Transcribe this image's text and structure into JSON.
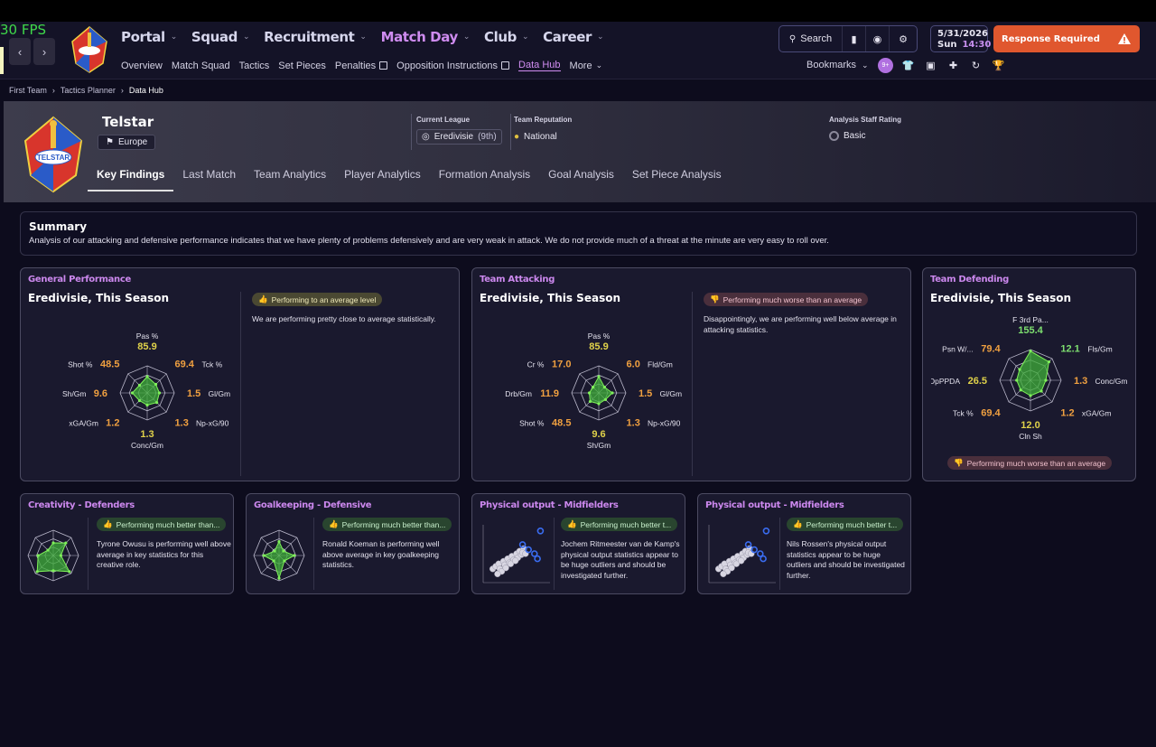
{
  "fps": "30 FPS",
  "nav": {
    "main": [
      {
        "label": "Portal",
        "active": false
      },
      {
        "label": "Squad",
        "active": false
      },
      {
        "label": "Recruitment",
        "active": false
      },
      {
        "label": "Match Day",
        "active": true
      },
      {
        "label": "Club",
        "active": false
      },
      {
        "label": "Career",
        "active": false
      }
    ],
    "sub": [
      {
        "label": "Overview",
        "active": false,
        "external": false
      },
      {
        "label": "Match Squad",
        "active": false,
        "external": false
      },
      {
        "label": "Tactics",
        "active": false,
        "external": false
      },
      {
        "label": "Set Pieces",
        "active": false,
        "external": false
      },
      {
        "label": "Penalties",
        "active": false,
        "external": true
      },
      {
        "label": "Opposition Instructions",
        "active": false,
        "external": true
      },
      {
        "label": "Data Hub",
        "active": true,
        "external": false
      },
      {
        "label": "More",
        "active": false,
        "external": false
      }
    ]
  },
  "toolbar": {
    "search_label": "Search",
    "date": "5/31/2026",
    "day": "Sun",
    "time": "14:30",
    "alert_label": "Response Required",
    "bookmarks_label": "Bookmarks",
    "chat_badge": "9+"
  },
  "breadcrumb": [
    "First Team",
    "Tactics Planner",
    "Data Hub"
  ],
  "team": {
    "name": "Telstar",
    "region": "Europe",
    "crest_text": "TELSTAR",
    "league_label": "Current League",
    "league_value": "Eredivisie",
    "league_position": "(9th)",
    "reputation_label": "Team Reputation",
    "reputation_value": "National",
    "staff_label": "Analysis Staff Rating",
    "staff_value": "Basic"
  },
  "tabs": [
    "Key Findings",
    "Last Match",
    "Team Analytics",
    "Player Analytics",
    "Formation Analysis",
    "Goal Analysis",
    "Set Piece Analysis"
  ],
  "summary": {
    "title": "Summary",
    "text": "Analysis of our attacking and defensive performance indicates that we have plenty of problems defensively and are very weak in attack. We do not provide much of a threat at the minute are very easy to roll over."
  },
  "cards": {
    "general": {
      "title": "General Performance",
      "subtitle": "Eredivisie, This Season",
      "badge": "Performing to an average level",
      "text": "We are performing pretty close to average statistically."
    },
    "attacking": {
      "title": "Team Attacking",
      "subtitle": "Eredivisie, This Season",
      "badge": "Performing much worse than an average",
      "text": "Disappointingly, we are performing well below average in attacking statistics."
    },
    "defending": {
      "title": "Team Defending",
      "subtitle": "Eredivisie, This Season",
      "badge": "Performing much worse than an average"
    },
    "creativity": {
      "title": "Creativity - Defenders",
      "badge": "Performing much better than...",
      "text": "Tyrone Owusu is performing well above average in key statistics for this creative role."
    },
    "goalkeeping": {
      "title": "Goalkeeping - Defensive",
      "badge": "Performing much better than...",
      "text": "Ronald Koeman is performing well above average in key goalkeeping statistics."
    },
    "physical1": {
      "title": "Physical output - Midfielders",
      "badge": "Performing much better t...",
      "text": "Jochem Ritmeester van de Kamp's physical output statistics appear to be huge outliers and should be investigated further."
    },
    "physical2": {
      "title": "Physical output - Midfielders",
      "badge": "Performing much better t...",
      "text": "Nils Rossen's physical output statistics appear to be huge outliers and should be investigated further."
    }
  },
  "colors": {
    "accent": "#cf8cf0",
    "alert": "#e0572e",
    "radar_fill": "#3fae3a",
    "radar_line": "#7ff05a",
    "value_orange": "#f0a040",
    "value_green": "#7ee070",
    "value_yellow": "#e0d24a"
  },
  "chart_data": [
    {
      "type": "radar",
      "name": "general",
      "axes": [
        "Pas %",
        "Tck %",
        "Gl/Gm",
        "Np-xG/90",
        "Conc/Gm",
        "xGA/Gm",
        "Sh/Gm",
        "Shot %"
      ],
      "values": [
        "85.9",
        "69.4",
        "1.5",
        "1.3",
        "1.3",
        "1.2",
        "9.6",
        "48.5"
      ],
      "levels": [
        0.6,
        0.45,
        0.45,
        0.5,
        0.45,
        0.4,
        0.55,
        0.4
      ]
    },
    {
      "type": "radar",
      "name": "attacking",
      "axes": [
        "Pas %",
        "Fld/Gm",
        "Gl/Gm",
        "Np-xG/90",
        "Sh/Gm",
        "Shot %",
        "Drb/Gm",
        "Cr %"
      ],
      "values": [
        "85.9",
        "6.0",
        "1.5",
        "1.3",
        "9.6",
        "48.5",
        "11.9",
        "17.0"
      ],
      "levels": [
        0.6,
        0.3,
        0.5,
        0.35,
        0.4,
        0.45,
        0.35,
        0.3
      ]
    },
    {
      "type": "radar",
      "name": "defending",
      "axes": [
        "F 3rd Pa...",
        "Fls/Gm",
        "Conc/Gm",
        "xGA/Gm",
        "Cln Sh",
        "Tck %",
        "OpPPDA",
        "Psn W/..."
      ],
      "values": [
        "155.4",
        "12.1",
        "1.3",
        "1.2",
        "12.0",
        "69.4",
        "26.5",
        "79.4"
      ],
      "levels": [
        0.95,
        0.85,
        0.5,
        0.5,
        0.5,
        0.45,
        0.45,
        0.5
      ]
    },
    {
      "type": "radar",
      "name": "creativity",
      "levels": [
        0.5,
        0.7,
        0.3,
        0.9,
        0.6,
        0.9,
        0.6,
        0.3
      ]
    },
    {
      "type": "radar",
      "name": "goalkeeping",
      "levels": [
        0.55,
        0.25,
        0.6,
        0.3,
        0.9,
        0.3,
        0.6,
        0.25
      ]
    },
    {
      "type": "scatter",
      "name": "physical1",
      "points": [
        [
          0.1,
          0.2
        ],
        [
          0.15,
          0.25
        ],
        [
          0.2,
          0.3
        ],
        [
          0.22,
          0.2
        ],
        [
          0.28,
          0.35
        ],
        [
          0.3,
          0.28
        ],
        [
          0.35,
          0.4
        ],
        [
          0.38,
          0.32
        ],
        [
          0.42,
          0.45
        ],
        [
          0.45,
          0.38
        ],
        [
          0.5,
          0.5
        ],
        [
          0.52,
          0.42
        ],
        [
          0.55,
          0.55
        ],
        [
          0.58,
          0.48
        ],
        [
          0.62,
          0.6
        ],
        [
          0.25,
          0.15
        ],
        [
          0.32,
          0.22
        ],
        [
          0.4,
          0.3
        ],
        [
          0.48,
          0.36
        ],
        [
          0.6,
          0.52
        ],
        [
          0.18,
          0.1
        ],
        [
          0.65,
          0.5
        ]
      ],
      "highlight": [
        [
          0.9,
          0.95
        ],
        [
          0.8,
          0.5
        ],
        [
          0.85,
          0.4
        ],
        [
          0.6,
          0.68
        ],
        [
          0.7,
          0.58
        ]
      ]
    },
    {
      "type": "scatter",
      "name": "physical2",
      "points": [
        [
          0.1,
          0.2
        ],
        [
          0.15,
          0.25
        ],
        [
          0.2,
          0.3
        ],
        [
          0.22,
          0.2
        ],
        [
          0.28,
          0.35
        ],
        [
          0.3,
          0.28
        ],
        [
          0.35,
          0.4
        ],
        [
          0.38,
          0.32
        ],
        [
          0.42,
          0.45
        ],
        [
          0.45,
          0.38
        ],
        [
          0.5,
          0.5
        ],
        [
          0.52,
          0.42
        ],
        [
          0.55,
          0.55
        ],
        [
          0.58,
          0.48
        ],
        [
          0.62,
          0.6
        ],
        [
          0.25,
          0.15
        ],
        [
          0.32,
          0.22
        ],
        [
          0.4,
          0.3
        ],
        [
          0.48,
          0.36
        ],
        [
          0.6,
          0.52
        ],
        [
          0.18,
          0.1
        ],
        [
          0.65,
          0.5
        ]
      ],
      "highlight": [
        [
          0.9,
          0.95
        ],
        [
          0.8,
          0.5
        ],
        [
          0.85,
          0.4
        ],
        [
          0.6,
          0.68
        ],
        [
          0.7,
          0.58
        ]
      ]
    }
  ]
}
